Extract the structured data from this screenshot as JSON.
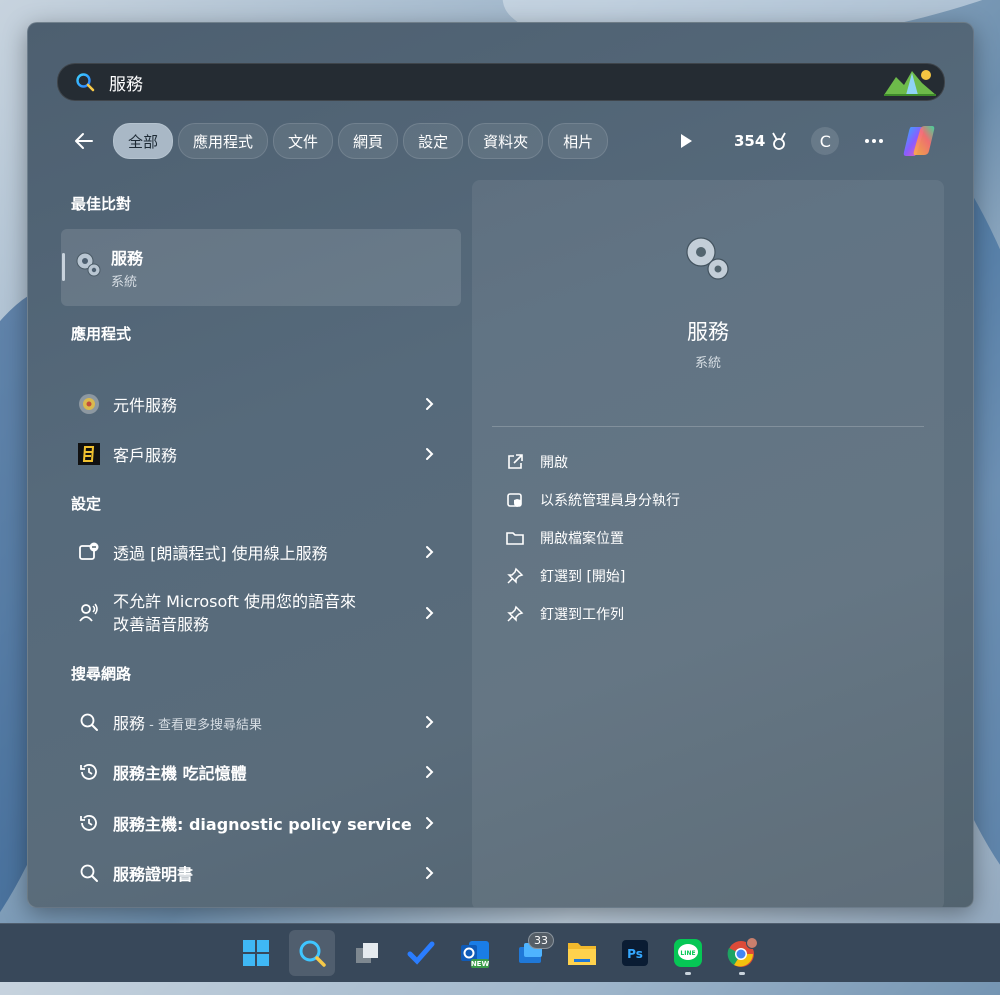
{
  "search": {
    "query": "服務"
  },
  "filters": {
    "chips": [
      "全部",
      "應用程式",
      "文件",
      "網頁",
      "設定",
      "資料夾",
      "相片"
    ],
    "active_index": 0,
    "points": "354",
    "avatar_letter": "C"
  },
  "best_match": {
    "section_title": "最佳比對",
    "name": "服務",
    "type": "系統"
  },
  "apps": {
    "section_title": "應用程式",
    "items": [
      {
        "label": "元件服務"
      },
      {
        "label": "客戶服務"
      }
    ]
  },
  "settings": {
    "section_title": "設定",
    "items": [
      {
        "label": "透過 [朗讀程式] 使用線上服務"
      },
      {
        "label_line1": "不允許 Microsoft 使用您的語音來",
        "label_line2": "改善語音服務"
      }
    ]
  },
  "web": {
    "section_title": "搜尋網路",
    "first": {
      "label": "服務",
      "suffix": " - 查看更多搜尋結果"
    },
    "items": [
      {
        "label": "服務主機 吃記憶體"
      },
      {
        "label": "服務主機: diagnostic policy service"
      },
      {
        "label": "服務證明書"
      }
    ]
  },
  "detail": {
    "name": "服務",
    "type": "系統",
    "actions": [
      {
        "label": "開啟",
        "icon": "open-external-icon"
      },
      {
        "label": "以系統管理員身分執行",
        "icon": "shield-admin-icon"
      },
      {
        "label": "開啟檔案位置",
        "icon": "folder-icon"
      },
      {
        "label": "釘選到 [開始]",
        "icon": "pin-icon"
      },
      {
        "label": "釘選到工作列",
        "icon": "pin-icon"
      }
    ]
  },
  "taskbar": {
    "icons": [
      "windows-start-icon",
      "search-icon",
      "task-view-icon",
      "todo-icon",
      "outlook-new-icon",
      "mail-icon",
      "file-explorer-icon",
      "photoshop-icon",
      "line-icon",
      "chrome-icon"
    ],
    "mail_badge": "33",
    "outlook_tag": "NEW",
    "photoshop_label": "Ps",
    "line_label": "LINE"
  },
  "colors": {
    "accent": "#a9b8c6",
    "panel": "#52646f",
    "search_bg": "#252c33"
  }
}
